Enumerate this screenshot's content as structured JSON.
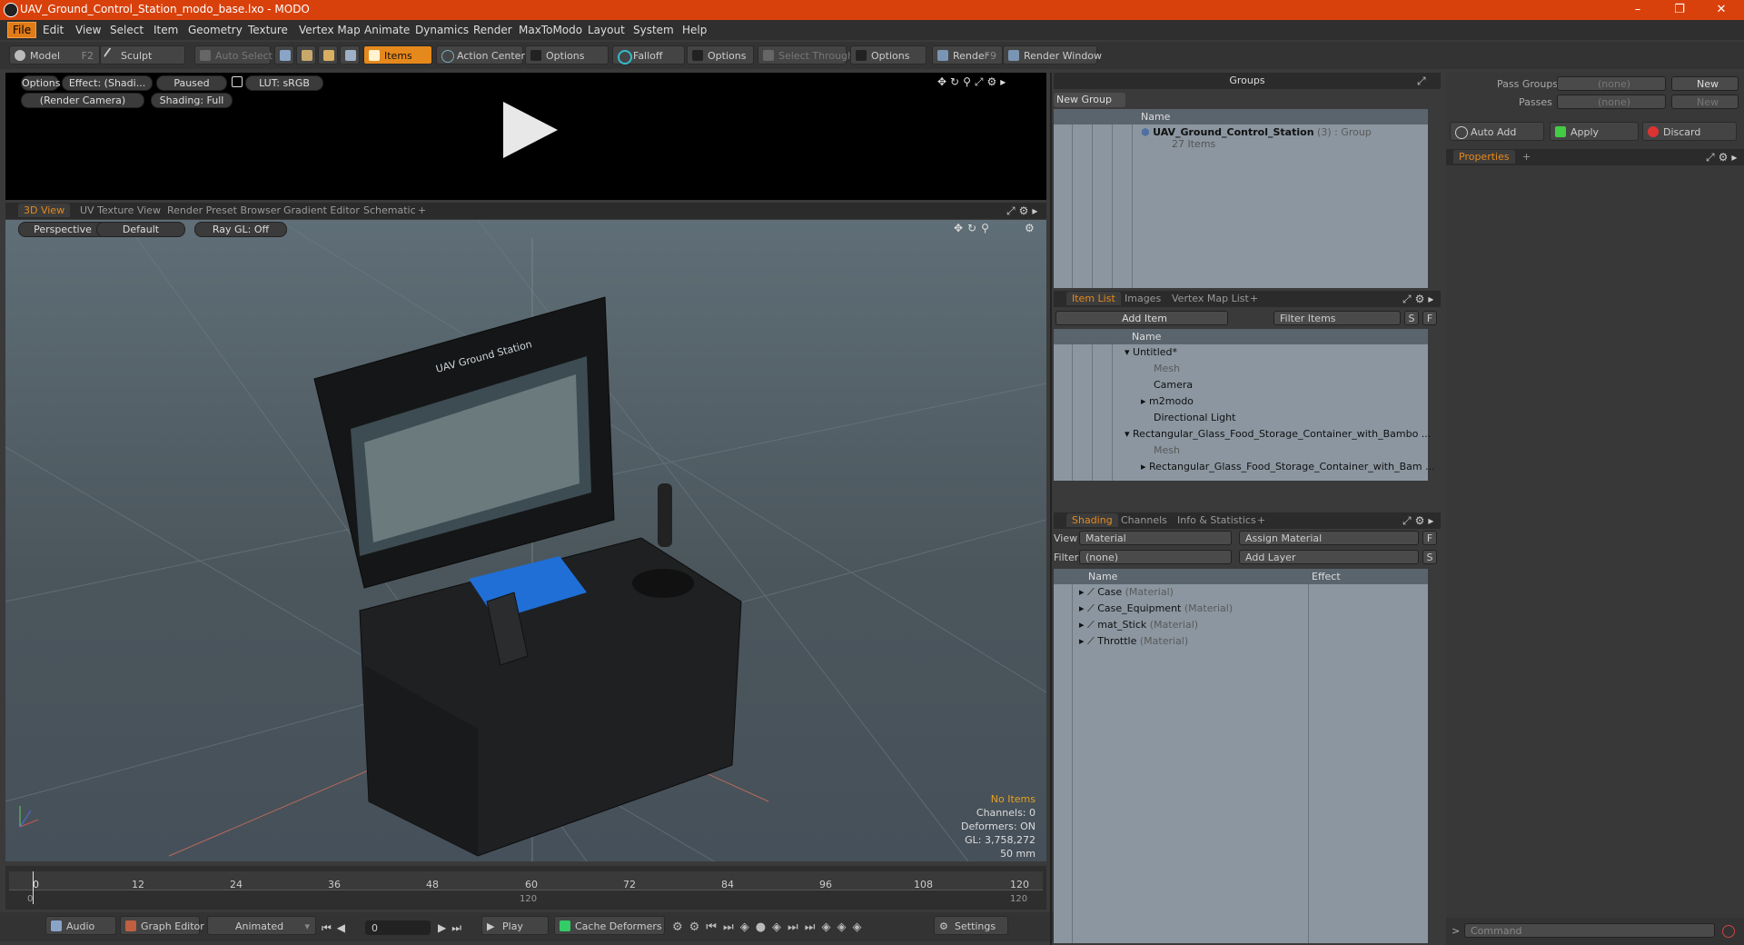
{
  "window": {
    "title": "UAV_Ground_Control_Station_modo_base.lxo - MODO",
    "minimize": "–",
    "restore": "❐",
    "close": "✕"
  },
  "menu": [
    "File",
    "Edit",
    "View",
    "Select",
    "Item",
    "Geometry",
    "Texture",
    "Vertex Map",
    "Animate",
    "Dynamics",
    "Render",
    "MaxToModo",
    "Layout",
    "System",
    "Help"
  ],
  "toolbar": {
    "model": "Model",
    "model_key": "F2",
    "sculpt": "Sculpt",
    "auto_select": "Auto Select",
    "items": "Items",
    "action_center": "Action Center",
    "options1": "Options",
    "falloff": "Falloff",
    "options2": "Options",
    "select_through": "Select Through",
    "options3": "Options",
    "render": "Render",
    "render_key": "F9",
    "render_window": "Render Window"
  },
  "preview": {
    "options": "Options",
    "effect": "Effect: (Shadi...",
    "paused": "Paused",
    "lut": "LUT: sRGB",
    "camera": "(Render Camera)",
    "shading": "Shading: Full"
  },
  "viewtabs": [
    "3D View",
    "UV Texture View",
    "Render Preset Browser",
    "Gradient Editor",
    "Schematic",
    "+"
  ],
  "viewport": {
    "perspective": "Perspective",
    "default": "Default",
    "raygl": "Ray GL: Off",
    "hud": {
      "no_items": "No Items",
      "channels": "Channels: 0",
      "deformers": "Deformers: ON",
      "gl": "GL: 3,758,272",
      "focal": "50 mm"
    },
    "case_label": "UAV Ground Station"
  },
  "timeline": {
    "ticks": [
      "0",
      "12",
      "24",
      "36",
      "48",
      "60",
      "72",
      "84",
      "96",
      "108",
      "120"
    ],
    "sub_left": "0",
    "sub_mid": "120",
    "sub_right": "120"
  },
  "bottombar": {
    "audio": "Audio",
    "graph_editor": "Graph Editor",
    "animated": "Animated",
    "frame": "0",
    "play": "Play",
    "cache_deformers": "Cache Deformers",
    "settings": "Settings"
  },
  "groups": {
    "title": "Groups",
    "new_group": "New Group",
    "col_name": "Name",
    "item_name": "UAV_Ground_Control_Station",
    "item_meta": "(3) : Group",
    "item_count": "27 Items"
  },
  "passes": {
    "pass_groups": "Pass Groups",
    "passes": "Passes",
    "none1": "(none)",
    "none2": "(none)",
    "new1": "New",
    "new2": "New",
    "auto_add": "Auto Add",
    "apply": "Apply",
    "discard": "Discard",
    "properties": "Properties",
    "command": "Command"
  },
  "itemlist": {
    "tabs": [
      "Item List",
      "Images",
      "Vertex Map List",
      "+"
    ],
    "add_item": "Add Item",
    "filter": "Filter Items",
    "col_name": "Name",
    "rows": [
      {
        "label": "Untitled*",
        "indent": 0,
        "gray": false
      },
      {
        "label": "Mesh",
        "indent": 1,
        "gray": true
      },
      {
        "label": "Camera",
        "indent": 1,
        "gray": false
      },
      {
        "label": "m2modo",
        "indent": 1,
        "gray": false
      },
      {
        "label": "Directional Light",
        "indent": 1,
        "gray": false
      },
      {
        "label": "Rectangular_Glass_Food_Storage_Container_with_Bambo ...",
        "indent": 0,
        "gray": false
      },
      {
        "label": "Mesh",
        "indent": 1,
        "gray": true
      },
      {
        "label": "Rectangular_Glass_Food_Storage_Container_with_Bam ...",
        "indent": 1,
        "gray": false
      }
    ]
  },
  "shading": {
    "tabs": [
      "Shading",
      "Channels",
      "Info & Statistics",
      "+"
    ],
    "view_label": "View",
    "view_value": "Material",
    "assign": "Assign Material",
    "filter_label": "Filter",
    "filter_value": "(none)",
    "add_layer": "Add Layer",
    "col_name": "Name",
    "col_effect": "Effect",
    "rows": [
      {
        "name": "Case",
        "type": "(Material)"
      },
      {
        "name": "Case_Equipment",
        "type": "(Material)"
      },
      {
        "name": "mat_Stick",
        "type": "(Material)"
      },
      {
        "name": "Throttle",
        "type": "(Material)"
      }
    ]
  }
}
